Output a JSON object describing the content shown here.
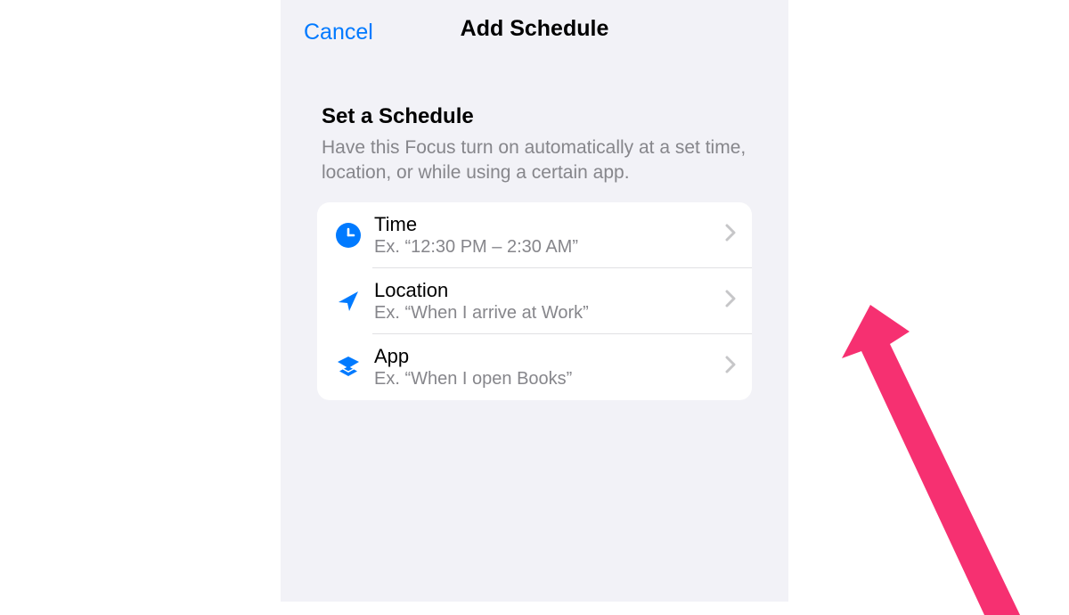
{
  "header": {
    "cancel_label": "Cancel",
    "title": "Add Schedule"
  },
  "section": {
    "title": "Set a Schedule",
    "subtitle": "Have this Focus turn on automatically at a set time, location, or while using a certain app."
  },
  "options": {
    "time": {
      "icon_name": "clock-icon",
      "title": "Time",
      "subtitle": "Ex. “12:30 PM – 2:30 AM”"
    },
    "location": {
      "icon_name": "location-arrow-icon",
      "title": "Location",
      "subtitle": "Ex. “When I arrive at Work”"
    },
    "app": {
      "icon_name": "stack-icon",
      "title": "App",
      "subtitle": "Ex. “When I open Books”"
    }
  },
  "colors": {
    "ios_blue": "#007aff",
    "annotation_pink": "#f63071"
  }
}
